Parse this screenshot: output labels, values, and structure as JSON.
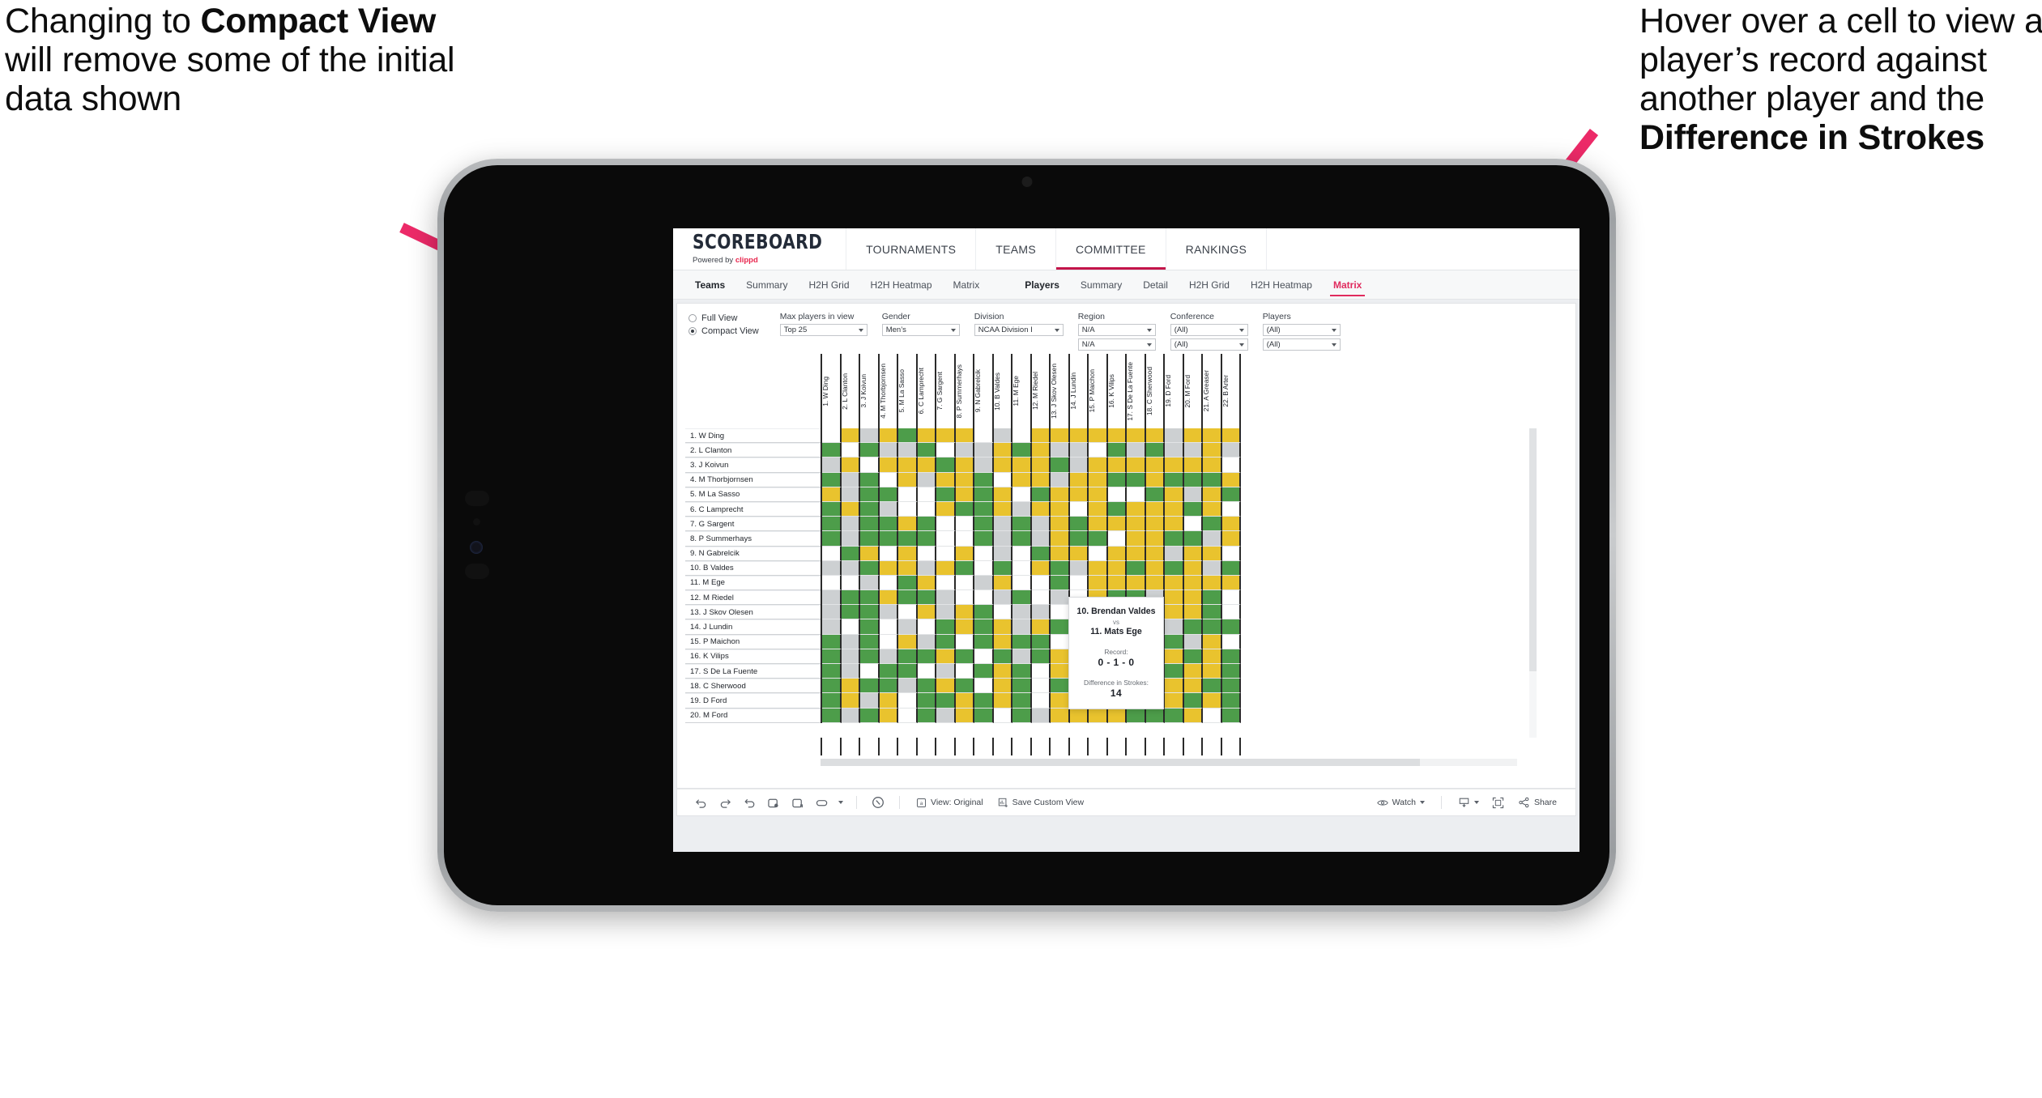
{
  "annotations": {
    "left": {
      "pre": "Changing to ",
      "bold": "Compact View",
      "post": " will remove some of the initial data shown"
    },
    "right": {
      "pre": "Hover over a cell to view a player’s record against another player and the ",
      "bold": "Difference in Strokes",
      "post": ""
    }
  },
  "app": {
    "brand": {
      "title": "SCOREBOARD",
      "sub_prefix": "Powered by ",
      "sub_brand": "clippd"
    },
    "top_nav": [
      {
        "label": "TOURNAMENTS",
        "active": false
      },
      {
        "label": "TEAMS",
        "active": false
      },
      {
        "label": "COMMITTEE",
        "active": true
      },
      {
        "label": "RANKINGS",
        "active": false
      }
    ],
    "sub_nav_group_1": [
      {
        "label": "Teams",
        "lead": true,
        "active": false
      },
      {
        "label": "Summary",
        "lead": false,
        "active": false
      },
      {
        "label": "H2H Grid",
        "lead": false,
        "active": false
      },
      {
        "label": "H2H Heatmap",
        "lead": false,
        "active": false
      },
      {
        "label": "Matrix",
        "lead": false,
        "active": false
      }
    ],
    "sub_nav_group_2": [
      {
        "label": "Players",
        "lead": true,
        "active": false
      },
      {
        "label": "Summary",
        "lead": false,
        "active": false
      },
      {
        "label": "Detail",
        "lead": false,
        "active": false
      },
      {
        "label": "H2H Grid",
        "lead": false,
        "active": false
      },
      {
        "label": "H2H Heatmap",
        "lead": false,
        "active": false
      },
      {
        "label": "Matrix",
        "lead": false,
        "active": true
      }
    ],
    "view_toggle": {
      "full_label": "Full View",
      "compact_label": "Compact View",
      "selected": "Compact View"
    },
    "filters": [
      {
        "label": "Max players in view",
        "values": [
          "Top 25"
        ],
        "width_class": "w-max"
      },
      {
        "label": "Gender",
        "values": [
          "Men’s"
        ],
        "width_class": "w-gen"
      },
      {
        "label": "Division",
        "values": [
          "NCAA Division I"
        ],
        "width_class": "w-div"
      },
      {
        "label": "Region",
        "values": [
          "N/A",
          "N/A"
        ],
        "width_class": "w-reg"
      },
      {
        "label": "Conference",
        "values": [
          "(All)",
          "(All)"
        ],
        "width_class": "w-con"
      },
      {
        "label": "Players",
        "values": [
          "(All)",
          "(All)"
        ],
        "width_class": "w-ply"
      }
    ],
    "tooltip": {
      "player_a": "10. Brendan Valdes",
      "vs": "vs",
      "player_b": "11. Mats Ege",
      "record_label": "Record:",
      "record_value": "0 - 1 - 0",
      "diff_label": "Difference in Strokes:",
      "diff_value": "14"
    },
    "toolbar": {
      "icons": [
        "undo-icon",
        "redo-icon",
        "revert-icon",
        "refresh-icon",
        "pause-icon",
        "pill-icon"
      ],
      "view_label": "View: Original",
      "save_label": "Save Custom View",
      "watch_label": "Watch",
      "share_label": "Share"
    }
  },
  "chart_data": {
    "type": "heatmap",
    "title": "Head-to-Head Matrix",
    "legend": {
      "green": "#4d9d4a",
      "yellow": "#e9c32e",
      "grey": "#cdd0d2",
      "white": "#ffffff"
    },
    "row_labels": [
      "1. W Ding",
      "2. L Clanton",
      "3. J Koivun",
      "4. M Thorbjornsen",
      "5. M La Sasso",
      "6. C Lamprecht",
      "7. G Sargent",
      "8. P Summerhays",
      "9. N Gabrelcik",
      "10. B Valdes",
      "11. M Ege",
      "12. M Riedel",
      "13. J Skov Olesen",
      "14. J Lundin",
      "15. P Maichon",
      "16. K Vilips",
      "17. S De La Fuente",
      "18. C Sherwood",
      "19. D Ford",
      "20. M Ford"
    ],
    "col_labels": [
      "1. W Ding",
      "2. L Clanton",
      "3. J Koivun",
      "4. M Thorbjornsen",
      "5. M La Sasso",
      "6. C Lamprecht",
      "7. G Sargent",
      "8. P Summerhays",
      "9. N Gabrelcik",
      "10. B Valdes",
      "11. M Ege",
      "12. M Riedel",
      "13. J Skov Olesen",
      "14. J Lundin",
      "15. P Maichon",
      "16. K Vilips",
      "17. S De La Fuente",
      "18. C Sherwood",
      "19. D Ford",
      "20. M Ford",
      "21. A Greaser",
      "22. B Arter"
    ],
    "cells": [
      [
        "w",
        "y",
        "a",
        "y",
        "g",
        "y",
        "y",
        "y",
        "w",
        "a",
        "w",
        "y",
        "y",
        "y",
        "y",
        "y",
        "y",
        "y",
        "a",
        "y",
        "y",
        "y"
      ],
      [
        "g",
        "w",
        "g",
        "a",
        "a",
        "g",
        "w",
        "a",
        "a",
        "y",
        "g",
        "y",
        "a",
        "a",
        "w",
        "g",
        "a",
        "g",
        "a",
        "a",
        "y",
        "a"
      ],
      [
        "a",
        "y",
        "w",
        "y",
        "y",
        "y",
        "g",
        "y",
        "a",
        "y",
        "y",
        "y",
        "g",
        "a",
        "y",
        "y",
        "y",
        "y",
        "y",
        "y",
        "y",
        "w"
      ],
      [
        "g",
        "a",
        "g",
        "w",
        "y",
        "a",
        "y",
        "y",
        "g",
        "w",
        "y",
        "y",
        "a",
        "y",
        "y",
        "g",
        "g",
        "y",
        "g",
        "g",
        "g",
        "y"
      ],
      [
        "y",
        "a",
        "g",
        "g",
        "w",
        "w",
        "g",
        "y",
        "g",
        "y",
        "w",
        "g",
        "y",
        "y",
        "y",
        "w",
        "w",
        "g",
        "y",
        "a",
        "y",
        "g"
      ],
      [
        "g",
        "y",
        "g",
        "a",
        "w",
        "w",
        "y",
        "g",
        "g",
        "y",
        "a",
        "y",
        "y",
        "w",
        "y",
        "g",
        "y",
        "y",
        "y",
        "g",
        "y",
        "w"
      ],
      [
        "g",
        "a",
        "g",
        "g",
        "y",
        "g",
        "w",
        "w",
        "g",
        "a",
        "g",
        "a",
        "y",
        "g",
        "y",
        "y",
        "y",
        "y",
        "y",
        "w",
        "g",
        "y"
      ],
      [
        "g",
        "a",
        "g",
        "g",
        "g",
        "g",
        "w",
        "w",
        "g",
        "a",
        "g",
        "a",
        "y",
        "g",
        "g",
        "w",
        "y",
        "y",
        "g",
        "g",
        "a",
        "y"
      ],
      [
        "w",
        "g",
        "y",
        "w",
        "y",
        "w",
        "w",
        "y",
        "w",
        "a",
        "w",
        "g",
        "y",
        "y",
        "w",
        "y",
        "y",
        "y",
        "a",
        "y",
        "y",
        "w"
      ],
      [
        "a",
        "a",
        "g",
        "y",
        "y",
        "a",
        "y",
        "g",
        "w",
        "g",
        "w",
        "y",
        "g",
        "a",
        "y",
        "y",
        "g",
        "y",
        "g",
        "y",
        "a",
        "g"
      ],
      [
        "w",
        "w",
        "a",
        "w",
        "g",
        "y",
        "w",
        "w",
        "a",
        "y",
        "w",
        "w",
        "g",
        "w",
        "y",
        "y",
        "y",
        "y",
        "y",
        "y",
        "y",
        "y"
      ],
      [
        "a",
        "g",
        "g",
        "y",
        "g",
        "g",
        "a",
        "w",
        "w",
        "a",
        "g",
        "w",
        "a",
        "w",
        "y",
        "g",
        "g",
        "a",
        "y",
        "y",
        "g",
        "w"
      ],
      [
        "a",
        "g",
        "g",
        "a",
        "w",
        "y",
        "a",
        "y",
        "g",
        "w",
        "a",
        "a",
        "w",
        "g",
        "y",
        "y",
        "y",
        "y",
        "y",
        "y",
        "g",
        "w"
      ],
      [
        "a",
        "w",
        "g",
        "w",
        "a",
        "w",
        "g",
        "y",
        "g",
        "y",
        "a",
        "y",
        "g",
        "w",
        "y",
        "y",
        "y",
        "a",
        "a",
        "g",
        "g",
        "g"
      ],
      [
        "g",
        "a",
        "g",
        "w",
        "y",
        "a",
        "g",
        "w",
        "g",
        "y",
        "g",
        "g",
        "w",
        "y",
        "y",
        "y",
        "y",
        "g",
        "g",
        "a",
        "y",
        "w"
      ],
      [
        "g",
        "a",
        "g",
        "a",
        "g",
        "g",
        "y",
        "g",
        "w",
        "g",
        "a",
        "g",
        "y",
        "w",
        "y",
        "g",
        "w",
        "g",
        "y",
        "g",
        "y",
        "g"
      ],
      [
        "g",
        "a",
        "w",
        "g",
        "g",
        "w",
        "a",
        "w",
        "g",
        "y",
        "g",
        "w",
        "y",
        "y",
        "y",
        "y",
        "w",
        "y",
        "g",
        "y",
        "y",
        "g"
      ],
      [
        "g",
        "y",
        "g",
        "g",
        "a",
        "g",
        "y",
        "g",
        "w",
        "y",
        "g",
        "w",
        "g",
        "y",
        "w",
        "g",
        "y",
        "y",
        "y",
        "y",
        "g",
        "g"
      ],
      [
        "g",
        "y",
        "a",
        "y",
        "w",
        "g",
        "g",
        "y",
        "g",
        "y",
        "g",
        "w",
        "y",
        "y",
        "y",
        "g",
        "w",
        "y",
        "y",
        "g",
        "y",
        "g"
      ],
      [
        "g",
        "a",
        "g",
        "y",
        "w",
        "g",
        "a",
        "y",
        "g",
        "w",
        "g",
        "a",
        "y",
        "y",
        "y",
        "y",
        "g",
        "g",
        "g",
        "y",
        "w",
        "g"
      ]
    ],
    "highlighted_cell": {
      "row": "10. B Valdes",
      "col": "11. M Ege",
      "record": "0 - 1 - 0",
      "difference_in_strokes": 14
    }
  }
}
